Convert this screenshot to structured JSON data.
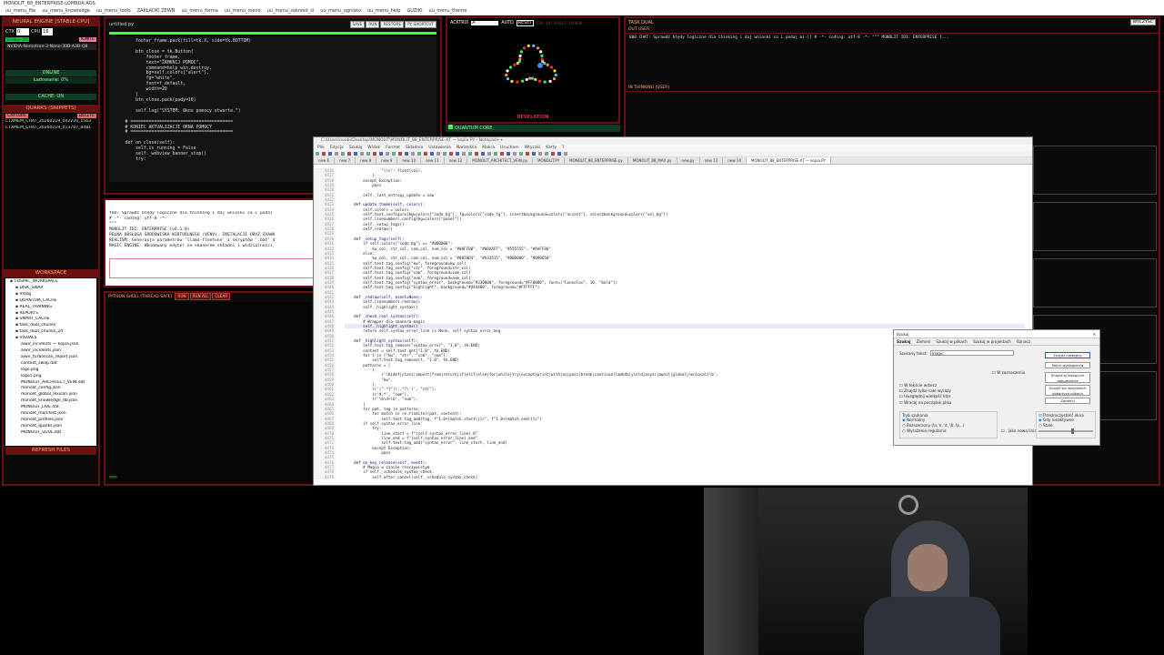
{
  "window": {
    "title": "MONOLIT_88_ENTERPRISE-LOMBDA AOS"
  },
  "menubar": [
    "uu_menu_file",
    "uu_menu_knowledge",
    "uu_menu_tools",
    "ZAKŁADKI ZEWN",
    "uu_menu_forma",
    "uu_menu_meno",
    "uu_menu_zakresd_si",
    "uu_menu_ognisko",
    "uu_menu_help",
    "GUZIKI",
    "uu_menu_theme"
  ],
  "left": {
    "engine_title": "NEURAL ENGINE [STABLE-CPU]",
    "ctx_label": "CTX",
    "ctx_value": "0",
    "cpu_label": "CPU",
    "cpu_value": "16",
    "badge": "STABLE-CPU",
    "ignite": "IGNITE",
    "model": "NVIDIA-Nemotron-3-Nano-30B-A3B-Q8",
    "online": "ONLINE",
    "loading": "Ładowanie: 0%",
    "cache": "CACHE: ON",
    "quarks_title": "QUARKS (SNIPPETS)",
    "capture": "CAPTURE",
    "delete": "DELETE",
    "snippets": [
      "CTXMEM_CHAT_20260219_002220_1563",
      "CTXMEM_CHAT_20260219_013707_8481"
    ],
    "workspace_title": "WORKSPACE",
    "tree": [
      "COSMIC_WORKSPACE",
      "DISK_SWAP",
      "m0zg",
      "QUANTUM_CACHE",
      "REAL_TRAINING",
      "REPORTS",
      "SMART_CACHE",
      "task_dual_chunks",
      "task_dual_chunks_2d",
      "VISUALS",
      "aiwir_incidents — kopia.json",
      "aiwir_incidents.json",
      "aiwir_turboscan_report.json",
      "context_swap.dat",
      "logo.png",
      "logo1.png",
      "MONOLIT_ARCHITECT_VEIN.dat",
      "monolit_config.json",
      "monolit_global_lexicon.json",
      "monolit_knowledge_db.json",
      "MONOLIT_LIVE.dat",
      "monolit_manifest.json",
      "monolit_profiles.json",
      "monolit_quarks.json",
      "MONOLIT_SOUL.dat"
    ],
    "refresh": "REFRESH FILES"
  },
  "editor": {
    "tab": "untitled.py",
    "buttons": [
      "SAVE",
      "RUN",
      "RESTORE",
      "PY SHORTCUT"
    ],
    "code": "        footer_frame.pack(fill=tk.X, side=tk.BOTTOM)\n\n        btn_close = tk.Button(\n            footer_frame,\n            text=\"ZAMKNIJ POMOC\",\n            command=help_win.destroy,\n            bg=self.colors[\"alert\"],\n            fg=\"white\",\n            font=f_default,\n            width=20\n        )\n        btn_close.pack(pady=10)\n\n        self.log(\"SYSTEM: Okno pomocy otwarte.\")\n\n    # =======================================\n    # KONIEC AKTUALIZACJI OKNA POMOCY\n    # =======================================\n\n    def on_close(self):\n        self.is_running = False\n        self._webview_banner_stop()\n        try:"
  },
  "prompt": {
    "text": "YOU: Sprawdź błędy logiczne dla thinking i daj wnioski co i poda]\n# -*- coding: utf-8 -*-\n\"\"\"\nMONOLIT IDI: ENTERPRISE (v6.1.0)\nPEŁNA OBSŁUGA ŚRODOWISKA WIRTUALNEGO (VENV), INSTALACJI ORAZ ZAAWA\nREALISM: Generacja parametrów 'llama-finetune' i skryptów '.bat' d\nMAGIC ENGINE: Wbudowany edytor ze skanerem składni i widzialności"
  },
  "shell": {
    "title": "PYTHON SHELL [THREAD SAFE]",
    "buttons": [
      "RUN",
      "RUN ALL",
      "CLEAR"
    ],
    "prompt": ">>>"
  },
  "viz": {
    "label": "ACKTRIX",
    "input": "A",
    "auto": "AUTO",
    "reset": "RESET",
    "status": "FPS: 34 | PIXELS: 100848",
    "caption": "REVELATION",
    "quantum": "QUANTUM CORE"
  },
  "right": {
    "title": "TASK DUAL",
    "clear": "WYCZYŚĆ",
    "out_label": "OUT USER",
    "out_text": "000 CHAT: Sprawdź błędy logiczne dla thinking i daj wnioski co i podaj mi-[] # -*- coding: utf-8 -*- \"\"\" MONOLIT IDI: ENTERPRISE [...",
    "thinking_label": "IN THINKING (USER)"
  },
  "notepad": {
    "title": "C:\\Users\\noobi\\Desktop\\MONOLIT\\MONOLIT_88_ENTERPRISE-XT — kopia.PY - Notepad++",
    "menu": [
      "Plik",
      "Edycja",
      "Szukaj",
      "Widok",
      "Format",
      "Składnia",
      "Ustawienia",
      "Narzędzia",
      "Makra",
      "Uruchom",
      "Wtyczki",
      "Karty",
      "?"
    ],
    "tabs": [
      "new 6",
      "new 7",
      "new 8",
      "new 9",
      "new 10",
      "new 11",
      "new 12",
      "MONOLIT_ARCHITECT_VEIN.py",
      "MONOLIT.PY",
      "MONOLIT_88_ENTERPRISE.py",
      "MONOLIT_88_MAX.py",
      "new.py",
      "new 13",
      "new 14",
      "MONOLIT_88_ENTERPRISE-XT — kopia.PY"
    ],
    "line_start": 4416,
    "lines": [
      "                \"\\\\s\": float(val),",
      "            }",
      "        except Exception:",
      "            pass",
      "",
      "        self._last_entropy_update = now",
      "",
      "    def update_theme(self, colors):",
      "        self.colors = colors",
      "        self.text.configure(bg=colors[\"code_bg\"], fg=colors[\"code_fg\"], insertbackground=colors[\"accent\"], selectbackground=colors[\"sel_bg\"])",
      "        self.linenumbers.config(bg=colors[\"panel\"])",
      "        self._setup_tags()",
      "        self.redraw()",
      "",
      "    def _setup_tags(self):",
      "        if self.colors[\"code_bg\"] == \"#000000\":",
      "            kw_col, str_col, com_col, num_col = \"#00FF00\", \"#00AAFF\", \"#555555\", \"#AAFF00\"",
      "        else:",
      "            kw_col, str_col, com_col, num_col = \"#0078D4\", \"#A31515\", \"#008000\", \"#098658\"",
      "        self.text.tag_config(\"kw\", foreground=kw_col)",
      "        self.text.tag_config(\"str\", foreground=str_col)",
      "        self.text.tag_config(\"com\", foreground=com_col)",
      "        self.text.tag_config(\"num\", foreground=num_col)",
      "        self.text.tag_config(\"syntax_error\", background=\"#330000\", foreground=\"#FF0000\", font=(\"Consolas\", 10, \"bold\"))",
      "        self.text.tag_config(\"highlight\", background=\"#444400\", foreground=\"#FFFFFF\")",
      "",
      "    def _redraw(self, event=None):",
      "        self.linenumbers.redraw()",
      "        self._highlight_syntax()",
      "",
      "    def _check_real_syntax(self):",
      "        # Wrapper dla skanera magic",
      "        self._highlight_syntax()",
      "        return self.syntax_error_line is None, self.syntax_error_msg",
      "",
      "    def _highlight_syntax(self):",
      "        self.text.tag_remove(\"syntax_error\", \"1.0\", tk.END)",
      "        content = self.text.get(\"1.0\", tk.END)",
      "        for t in [\"kw\", \"str\", \"com\", \"num\"]:",
      "            self.text.tag_remove(t, \"1.0\", tk.END)",
      "        patterns = [",
      "            (",
      "                r'\\b(def|class|import|from|return|if|elif|else|for|while|try|except|print|with|as|pass|break|continue|lambda|yield|async|await|global|nonlocal)\\b',",
      "                \"kw\",",
      "            ),",
      "            (r'(\".*?\"|\\'.*?\\')', \"str\"),",
      "            (r'#.*', \"com\"),",
      "            (r'\\b\\d+\\b', \"num\"),",
      "        ]",
      "        for pat, tag in patterns:",
      "            for match in re.finditer(pat, content):",
      "                self.text.tag_add(tag, f\"1.0+{match.start()}c\", f\"1.0+{match.end()}c\")",
      "        if self.syntax_error_line:",
      "            try:",
      "                line_start = f\"{self.syntax_error_line}.0\"",
      "                line_end = f\"{self.syntax_error_line}.end\"",
      "                self.text.tag_add(\"syntax_error\", line_start, line_end)",
      "            except Exception:",
      "                pass",
      "",
      "    def on_key_release(self, event):",
      "        # Magia w czasie rzeczywistym",
      "        if self._schedule_syntax_check:",
      "            self.after_cancel(self._schedule_syntax_check)",
      "        self._schedule_syntax_check = self.after(600, self._run_magic_scan)  # Zmienic na 300ms"
    ]
  },
  "dialog": {
    "title": "Szukaj",
    "tabs": [
      "Szukaj",
      "Zamień",
      "Szukaj w plikach",
      "Szukaj w projektach",
      "Oznacz"
    ],
    "find_label": "Szukany tekst:",
    "find_value": "magic",
    "buttons": [
      "Znajdź następny",
      "Policz wystąpienia",
      "Znajdź w bieżącym dokumencie",
      "Znajdź we wszystkich otwartych plikach",
      "Zamknij"
    ],
    "in_selection": "W zaznaczeniu",
    "options": [
      "W tekście wstecz",
      "Znajdź tylko całe wyrazy",
      "Uwzględnij wielkość liter",
      "Wracaj na początek pliku"
    ],
    "mode_title": "Tryb szukania",
    "modes": [
      "Normalny",
      "Rozszerzony (\\n, \\r, \\t, \\0, \\x...)",
      "Wyrażenie regularne"
    ],
    "dotall": ". jako nowa linia",
    "transparency_title": "Przezroczystość okna",
    "transparency": [
      "Gdy nieaktywne",
      "Stale"
    ]
  },
  "colors": {
    "frame": "#6a1010",
    "accent": "#ffb070",
    "green": "#0e3b24"
  }
}
